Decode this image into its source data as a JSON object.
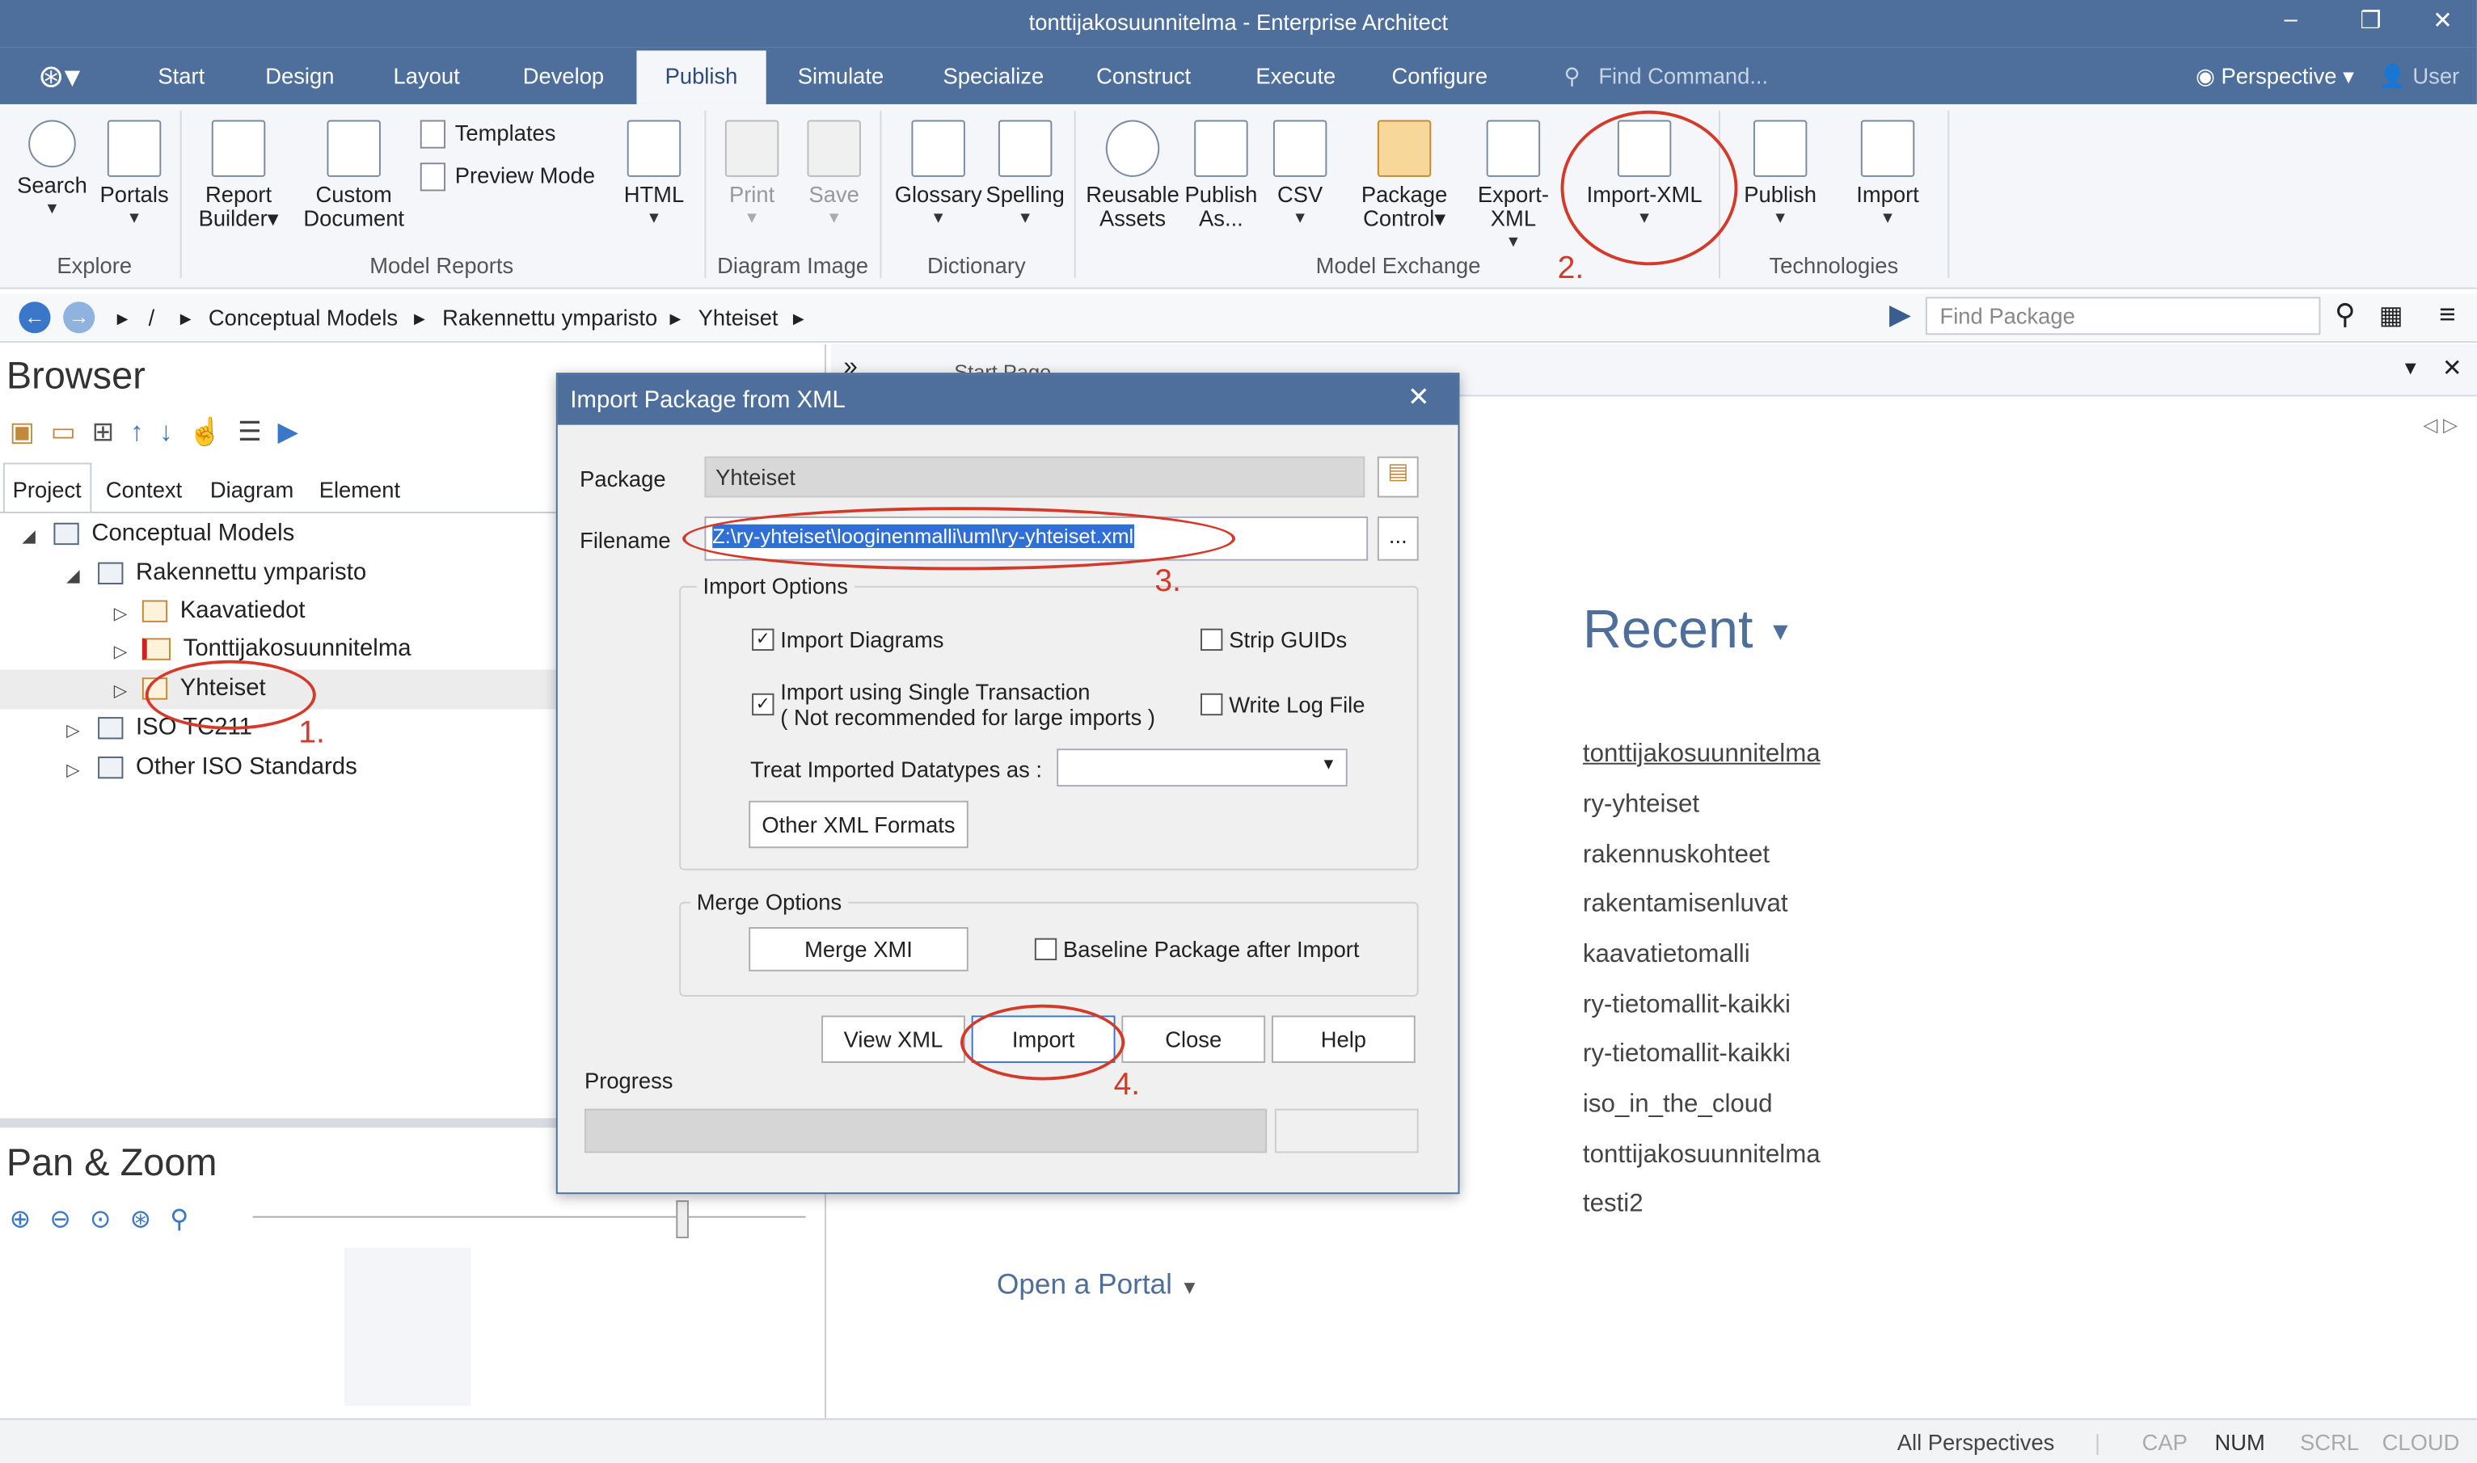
{
  "window": {
    "title": "tonttijakosuunnitelma - Enterprise Architect"
  },
  "menu": {
    "tabs": [
      "Start",
      "Design",
      "Layout",
      "Develop",
      "Publish",
      "Simulate",
      "Specialize",
      "Construct",
      "Execute",
      "Configure"
    ],
    "active": "Publish",
    "find_command": "Find Command...",
    "perspective": "Perspective",
    "user": "User"
  },
  "ribbon": {
    "explore": {
      "search": "Search",
      "portals": "Portals",
      "caption": "Explore"
    },
    "model_reports": {
      "report_builder": "Report Builder",
      "custom_document_1": "Custom",
      "custom_document_2": "Document",
      "templates": "Templates",
      "preview_mode": "Preview Mode",
      "html": "HTML",
      "caption": "Model Reports"
    },
    "diagram_image": {
      "print": "Print",
      "save": "Save",
      "caption": "Diagram Image"
    },
    "dictionary": {
      "glossary": "Glossary",
      "spelling": "Spelling",
      "caption": "Dictionary"
    },
    "model_exchange": {
      "reusable_1": "Reusable",
      "reusable_2": "Assets",
      "publish_as_1": "Publish",
      "publish_as_2": "As...",
      "csv": "CSV",
      "package_control_1": "Package",
      "package_control_2": "Control",
      "export_xml": "Export-XML",
      "import_xml": "Import-XML",
      "caption": "Model Exchange"
    },
    "technologies": {
      "publish": "Publish",
      "import": "Import",
      "caption": "Technologies"
    }
  },
  "navbar": {
    "root": "/",
    "crumbs": [
      "Conceptual Models",
      "Rakennettu ymparisto",
      "Yhteiset"
    ],
    "find_package": "Find Package"
  },
  "browser": {
    "title": "Browser",
    "tabs": [
      "Project",
      "Context",
      "Diagram",
      "Element"
    ],
    "tree": {
      "root": "Conceptual Models",
      "model": "Rakennettu ymparisto",
      "pkg1": "Kaavatiedot",
      "pkg2": "Tonttijakosuunnitelma",
      "pkg3": "Yhteiset",
      "iso": "ISO TC211",
      "other": "Other ISO Standards"
    }
  },
  "pan_zoom": {
    "title": "Pan & Zoom"
  },
  "main": {
    "start_page_tab": "Start Page",
    "recent_title": "Recent",
    "recent": [
      "tonttijakosuunnitelma",
      "ry-yhteiset",
      "rakennuskohteet",
      "rakentamisenluvat",
      "kaavatietomalli",
      "ry-tietomallit-kaikki",
      "ry-tietomallit-kaikki",
      "iso_in_the_cloud",
      "tonttijakosuunnitelma",
      "testi2"
    ],
    "open_portal": "Open a Portal"
  },
  "dialog": {
    "title": "Import Package from XML",
    "package_label": "Package",
    "package_value": "Yhteiset",
    "filename_label": "Filename",
    "filename_value": "Z:\\ry-yhteiset\\looginenmalli\\uml\\ry-yhteiset.xml",
    "browse": "...",
    "import_options": "Import Options",
    "import_diagrams": "Import Diagrams",
    "strip_guids": "Strip GUIDs",
    "single_transaction_1": "Import using Single Transaction",
    "single_transaction_2": "( Not recommended for large imports )",
    "write_log": "Write Log File",
    "treat_datatypes": "Treat Imported Datatypes as :",
    "other_formats": "Other XML Formats",
    "merge_options": "Merge Options",
    "merge_xmi": "Merge XMI",
    "baseline": "Baseline Package after Import",
    "view_xml": "View XML",
    "import": "Import",
    "close": "Close",
    "help": "Help",
    "progress": "Progress"
  },
  "annotations": {
    "n1": "1.",
    "n2": "2.",
    "n3": "3.",
    "n4": "4."
  },
  "status": {
    "perspectives": "All Perspectives",
    "cap": "CAP",
    "num": "NUM",
    "scrl": "SCRL",
    "cloud": "CLOUD"
  },
  "colors": {
    "titlebar": "#4e6f9b",
    "annotation": "#d33a2a",
    "accent": "#3a77c8"
  }
}
